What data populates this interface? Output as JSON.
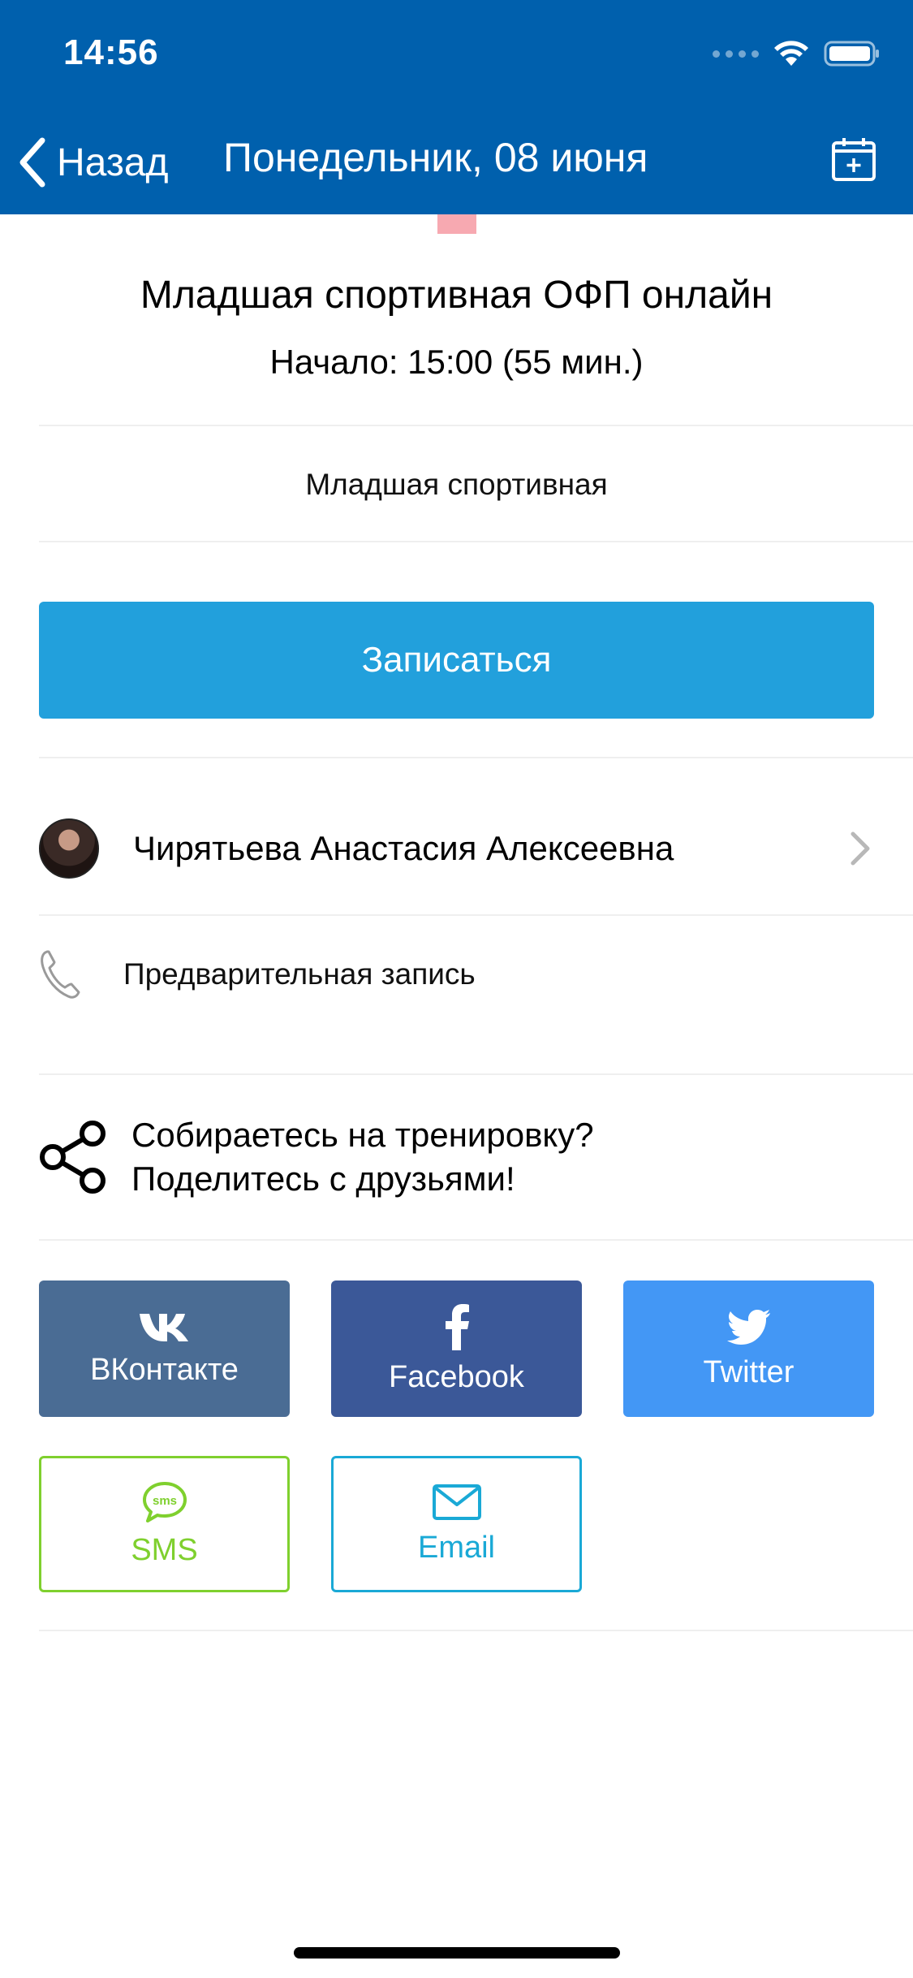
{
  "status_bar": {
    "time": "14:56"
  },
  "nav": {
    "back_label": "Назад",
    "title": "Понедельник, 08 июня"
  },
  "event": {
    "title": "Младшая спортивная ОФП онлайн",
    "start": "Начало: 15:00 (55 мин.)",
    "group": "Младшая спортивная"
  },
  "signup_button": "Записаться",
  "trainer": {
    "name": "Чирятьева Анастасия Алексеевна"
  },
  "booking": {
    "label": "Предварительная запись"
  },
  "share": {
    "line1": "Собираетесь на тренировку?",
    "line2": "Поделитесь с друзьями!",
    "buttons": {
      "vk": "ВКонтакте",
      "facebook": "Facebook",
      "twitter": "Twitter",
      "sms": "SMS",
      "email": "Email"
    }
  },
  "colors": {
    "header": "#0060ad",
    "signup": "#22a0dc",
    "vk": "#4a6c94",
    "facebook": "#3b5898",
    "twitter": "#4397f5",
    "sms": "#7fd02e",
    "email": "#1aa9d6"
  }
}
